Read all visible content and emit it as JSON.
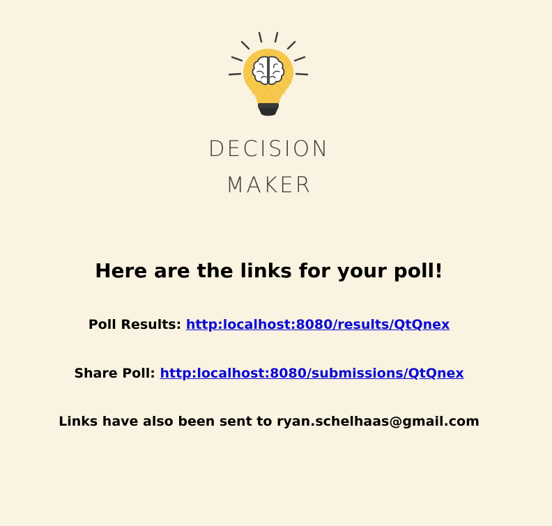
{
  "logo": {
    "line1": "DECISION",
    "line2": "MAKER",
    "icon": "lightbulb-brain-icon"
  },
  "heading": "Here are the links for your poll!",
  "results": {
    "label": "Poll Results:",
    "link": "http:localhost:8080/results/QtQnex"
  },
  "share": {
    "label": "Share Poll:",
    "link": "http:localhost:8080/submissions/QtQnex"
  },
  "email_notice": "Links have also been sent to ryan.schelhaas@gmail.com",
  "colors": {
    "background": "#fbf3e1",
    "bulb": "#f6c84c",
    "link": "#0a0ad6"
  }
}
